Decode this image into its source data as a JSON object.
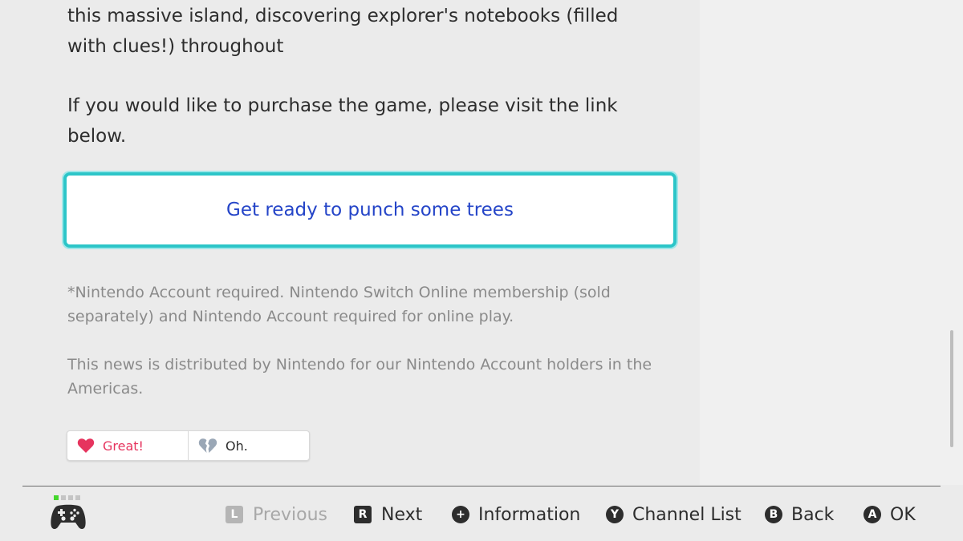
{
  "article": {
    "para1": "this massive island, discovering explorer's notebooks (filled with clues!) throughout",
    "para2": "If you would like to purchase the game, please visit the link below.",
    "link_label": "Get ready to punch some trees",
    "note1": "*Nintendo Account required. Nintendo Switch Online membership (sold separately) and Nintendo Account required for online play.",
    "note2": "This news is distributed by Nintendo for our Nintendo Account holders in the Americas."
  },
  "reactions": {
    "great_label": "Great!",
    "oh_label": "Oh.",
    "great_icon": "heart-icon",
    "oh_icon": "broken-heart-icon"
  },
  "footer": {
    "controller_icon": "pro-controller-icon",
    "previous": {
      "key": "L",
      "label": "Previous",
      "enabled": false
    },
    "next": {
      "key": "R",
      "label": "Next"
    },
    "information": {
      "key": "+",
      "label": "Information"
    },
    "channel_list": {
      "key": "Y",
      "label": "Channel List"
    },
    "back": {
      "key": "B",
      "label": "Back"
    },
    "ok": {
      "key": "A",
      "label": "OK"
    }
  },
  "colors": {
    "background": "#ebebeb",
    "accent_border": "#2cc5c8",
    "link_text": "#2545c8",
    "great_red": "#e6345e",
    "controller_active": "#44d62c"
  }
}
